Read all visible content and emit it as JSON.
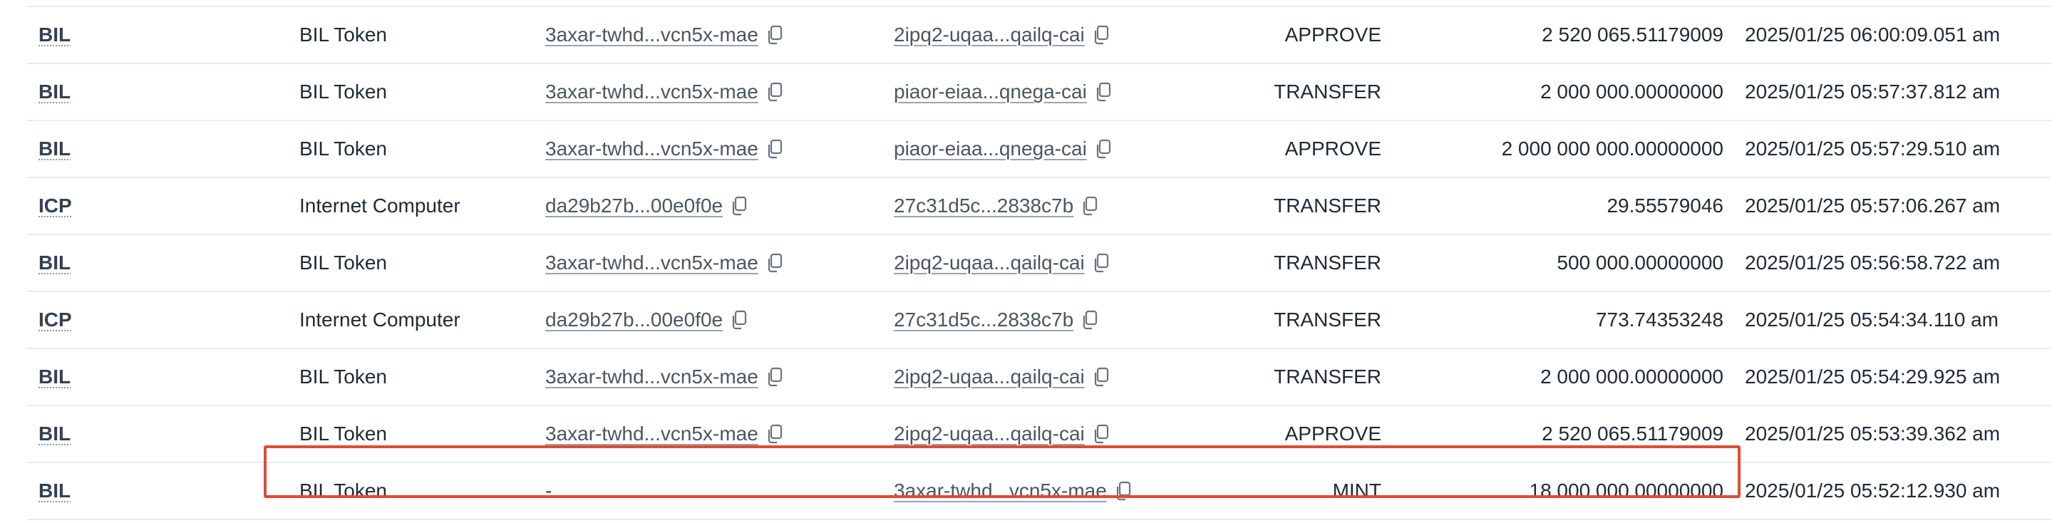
{
  "table": {
    "rows": [
      {
        "symbol": "BIL",
        "name": "BIL Token",
        "from": "3axar-twhd...vcn5x-mae",
        "to": "2ipq2-uqaa...qailq-cai",
        "type": "APPROVE",
        "amount": "2 520 065.51179009",
        "time": "2025/01/25 06:00:09.051 am"
      },
      {
        "symbol": "BIL",
        "name": "BIL Token",
        "from": "3axar-twhd...vcn5x-mae",
        "to": "piaor-eiaa...qnega-cai",
        "type": "TRANSFER",
        "amount": "2 000 000.00000000",
        "time": "2025/01/25 05:57:37.812 am"
      },
      {
        "symbol": "BIL",
        "name": "BIL Token",
        "from": "3axar-twhd...vcn5x-mae",
        "to": "piaor-eiaa...qnega-cai",
        "type": "APPROVE",
        "amount": "2 000 000 000.00000000",
        "time": "2025/01/25 05:57:29.510 am"
      },
      {
        "symbol": "ICP",
        "name": "Internet Computer",
        "from": "da29b27b...00e0f0e",
        "to": "27c31d5c...2838c7b",
        "type": "TRANSFER",
        "amount": "29.55579046",
        "time": "2025/01/25 05:57:06.267 am"
      },
      {
        "symbol": "BIL",
        "name": "BIL Token",
        "from": "3axar-twhd...vcn5x-mae",
        "to": "2ipq2-uqaa...qailq-cai",
        "type": "TRANSFER",
        "amount": "500 000.00000000",
        "time": "2025/01/25 05:56:58.722 am"
      },
      {
        "symbol": "ICP",
        "name": "Internet Computer",
        "from": "da29b27b...00e0f0e",
        "to": "27c31d5c...2838c7b",
        "type": "TRANSFER",
        "amount": "773.74353248",
        "time": "2025/01/25 05:54:34.110 am"
      },
      {
        "symbol": "BIL",
        "name": "BIL Token",
        "from": "3axar-twhd...vcn5x-mae",
        "to": "2ipq2-uqaa...qailq-cai",
        "type": "TRANSFER",
        "amount": "2 000 000.00000000",
        "time": "2025/01/25 05:54:29.925 am"
      },
      {
        "symbol": "BIL",
        "name": "BIL Token",
        "from": "3axar-twhd...vcn5x-mae",
        "to": "2ipq2-uqaa...qailq-cai",
        "type": "APPROVE",
        "amount": "2 520 065.51179009",
        "time": "2025/01/25 05:53:39.362 am"
      },
      {
        "symbol": "BIL",
        "name": "BIL Token",
        "from": "-",
        "to": "3axar-twhd...vcn5x-mae",
        "type": "MINT",
        "amount": "18 000 000.00000000",
        "time": "2025/01/25 05:52:12.930 am"
      }
    ]
  },
  "icons": {
    "copy": "copy-icon"
  },
  "colors": {
    "highlight": "#e34a33",
    "divider": "#e9ebee"
  }
}
